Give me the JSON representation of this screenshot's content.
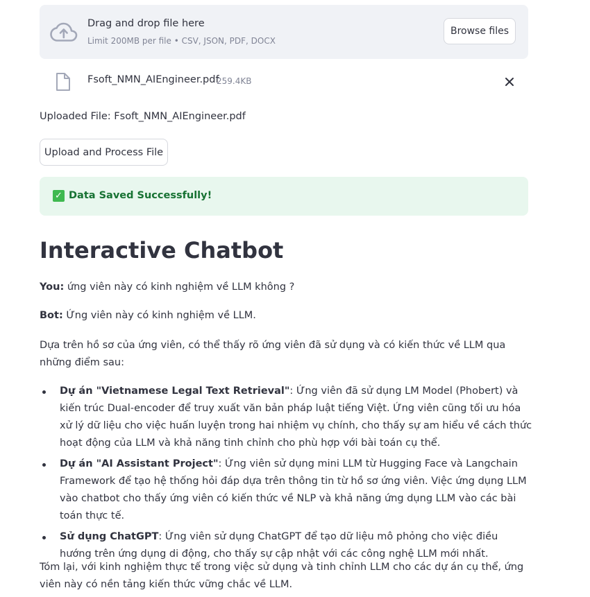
{
  "uploader": {
    "title": "Drag and drop file here",
    "limit": "Limit 200MB per file • CSV, JSON, PDF, DOCX",
    "browse_label": "Browse files",
    "icon": "cloud-upload-icon"
  },
  "file": {
    "name": "Fsoft_NMN_AIEngineer.pdf",
    "size": "259.4KB",
    "icon": "file-icon",
    "remove_icon": "close-icon"
  },
  "uploaded_label": "Uploaded File: Fsoft_NMN_AIEngineer.pdf",
  "process_button": "Upload and Process File",
  "alert": {
    "check": "✓",
    "text": "Data Saved Successfully!",
    "color": "#177233",
    "background": "#e8f7ee"
  },
  "chat": {
    "title": "Interactive Chatbot",
    "you_label": "You:",
    "you_text": "ứng viên này có kinh nghiệm về LLM không ?",
    "bot_label": "Bot:",
    "bot_text": "Ứng viên này có kinh nghiệm về LLM.",
    "intro": "Dựa trên hồ sơ của ứng viên, có thể thấy rõ ứng viên đã sử dụng và có kiến thức về LLM qua những điểm sau:",
    "bullets": [
      {
        "bold": "Dự án \"Vietnamese Legal Text Retrieval\"",
        "text": ": Ứng viên đã sử dụng LM Model (Phobert) và kiến trúc Dual-encoder để truy xuất văn bản pháp luật tiếng Việt. Ứng viên cũng tối ưu hóa xử lý dữ liệu cho việc huấn luyện trong hai nhiệm vụ chính, cho thấy sự am hiểu về cách thức hoạt động của LLM và khả năng tinh chỉnh cho phù hợp với bài toán cụ thể."
      },
      {
        "bold": "Dự án \"AI Assistant Project\"",
        "text": ": Ứng viên sử dụng mini LLM từ Hugging Face và Langchain Framework để tạo hệ thống hỏi đáp dựa trên thông tin từ hồ sơ ứng viên. Việc ứng dụng LLM vào chatbot cho thấy ứng viên có kiến thức về NLP và khả năng ứng dụng LLM vào các bài toán thực tế."
      },
      {
        "bold": "Sử dụng ChatGPT",
        "text": ": Ứng viên sử dụng ChatGPT để tạo dữ liệu mô phỏng cho việc điều hướng trên ứng dụng di động, cho thấy sự cập nhật với các công nghệ LLM mới nhất."
      }
    ],
    "conclusion": "Tóm lại, với kinh nghiệm thực tế trong việc sử dụng và tinh chỉnh LLM cho các dự án cụ thể, ứng viên này có nền tảng kiến thức vững chắc về LLM."
  }
}
